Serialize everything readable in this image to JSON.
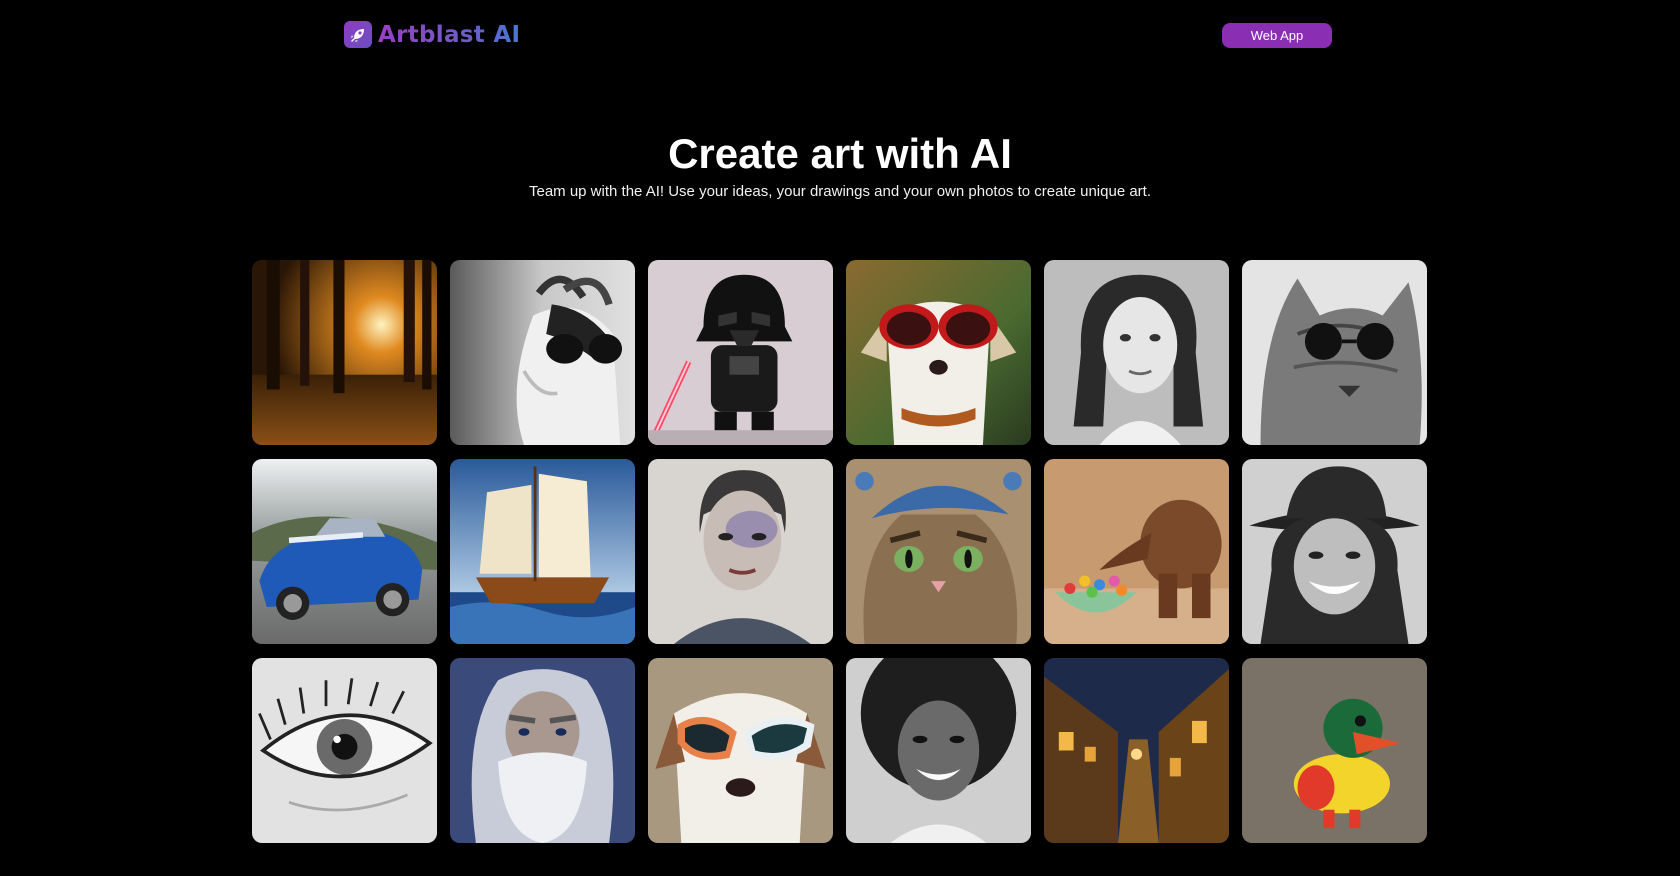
{
  "header": {
    "logo_text": "Artblast AI",
    "logo_icon": "rocket-icon",
    "web_app_label": "Web App"
  },
  "hero": {
    "title": "Create art with AI",
    "subtitle": "Team up with the AI! Use your ideas, your drawings and your own photos to create unique art."
  },
  "colors": {
    "background": "#000000",
    "accent": "#8a2eb3",
    "logo_gradient_start": "#9a3fc3",
    "logo_gradient_end": "#4a77d0"
  },
  "gallery": [
    {
      "name": "forest-sunset-image",
      "subject": "forest-sunset"
    },
    {
      "name": "goat-sunglasses-image",
      "subject": "goat-sunglasses"
    },
    {
      "name": "darth-vader-figure-image",
      "subject": "darth-vader"
    },
    {
      "name": "dog-red-sunglasses-image",
      "subject": "dog-sunglasses"
    },
    {
      "name": "woman-portrait-image",
      "subject": "woman-portrait"
    },
    {
      "name": "cat-sunglasses-image",
      "subject": "cat-sunglasses"
    },
    {
      "name": "blue-sports-car-image",
      "subject": "sports-car"
    },
    {
      "name": "sailing-ship-image",
      "subject": "sailing-ship"
    },
    {
      "name": "painted-girl-image",
      "subject": "painted-girl"
    },
    {
      "name": "cat-blue-hat-image",
      "subject": "cat-hat"
    },
    {
      "name": "wooden-elephant-candy-image",
      "subject": "wooden-elephant"
    },
    {
      "name": "woman-hat-smiling-image",
      "subject": "woman-hat"
    },
    {
      "name": "eye-closeup-image",
      "subject": "eye-closeup"
    },
    {
      "name": "old-wizard-image",
      "subject": "old-wizard"
    },
    {
      "name": "puppy-sunglasses-image",
      "subject": "puppy-sunglasses"
    },
    {
      "name": "woman-afro-portrait-image",
      "subject": "woman-afro"
    },
    {
      "name": "night-street-image",
      "subject": "night-street"
    },
    {
      "name": "rubber-duck-image",
      "subject": "rubber-duck"
    }
  ]
}
